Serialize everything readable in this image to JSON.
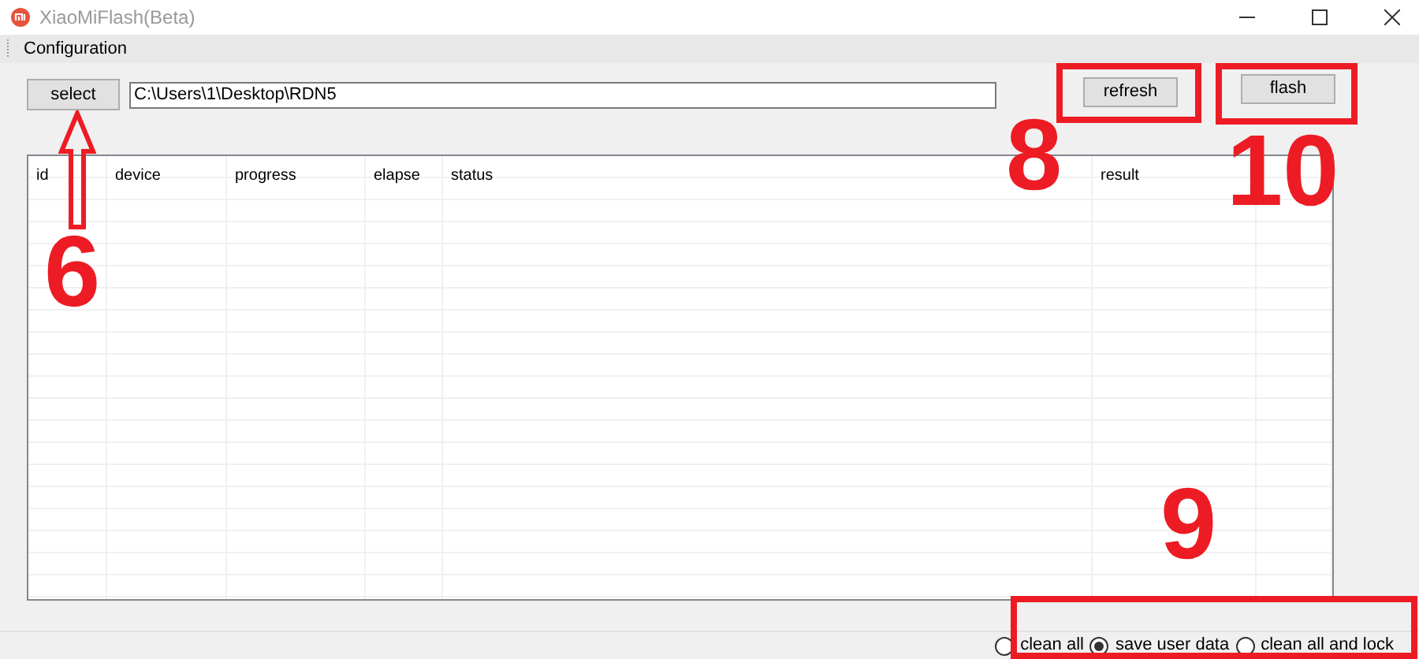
{
  "window": {
    "title": "XiaoMiFlash(Beta)"
  },
  "menu": [
    "Configuration"
  ],
  "select_button": "select",
  "path_field": {
    "value": "C:\\Users\\1\\Desktop\\RDN5"
  },
  "refresh_button": "refresh",
  "flash_button": "flash",
  "table": {
    "columns": [
      "id",
      "device",
      "progress",
      "elapse",
      "status",
      "result",
      ""
    ]
  },
  "options": [
    {
      "label": "clean all",
      "selected": false
    },
    {
      "label": "save user data",
      "selected": true
    },
    {
      "label": "clean all and lock",
      "selected": false
    }
  ],
  "annotations": [
    {
      "kind": "select",
      "number": "6"
    },
    {
      "kind": "refresh",
      "number": "8"
    },
    {
      "kind": "options",
      "number": "9"
    },
    {
      "kind": "flash",
      "number": "10"
    }
  ]
}
